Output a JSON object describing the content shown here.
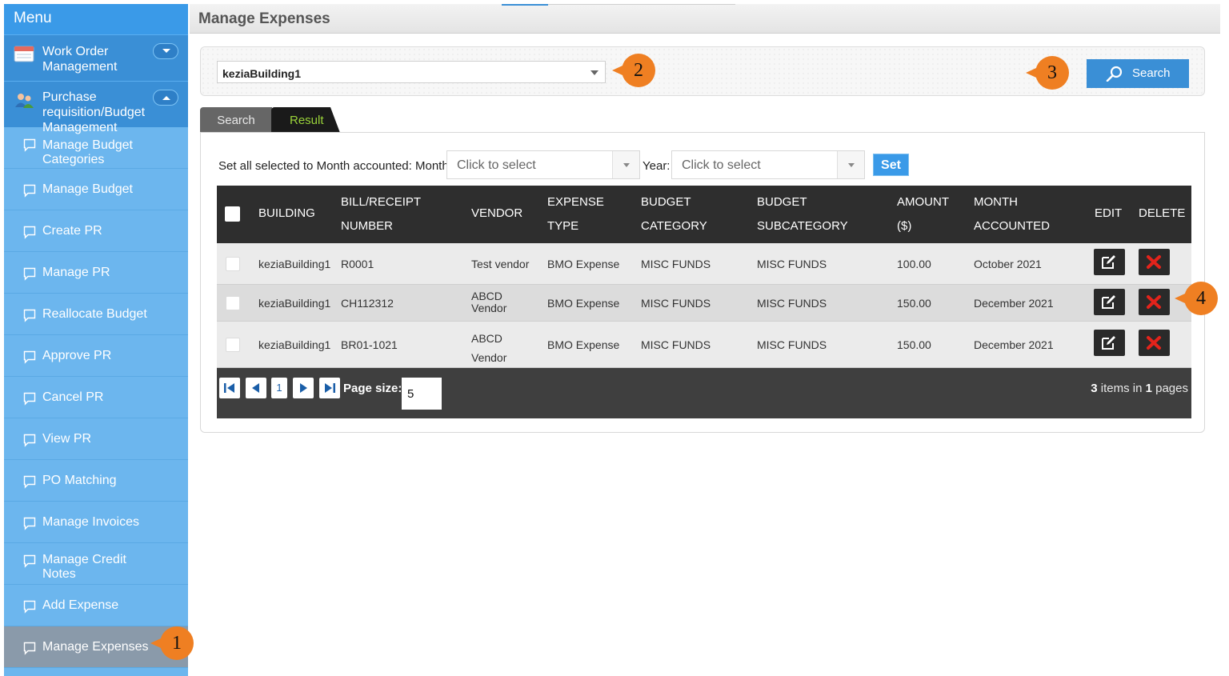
{
  "sidebar": {
    "title": "Menu",
    "groups": [
      {
        "label_line1": "Work Order",
        "label_line2": "Management",
        "icon": "calendar-icon",
        "expanded": false
      },
      {
        "label_line1": "Purchase",
        "label_line2": "requisition/Budget",
        "label_line3": "Management",
        "icon": "users-icon",
        "expanded": true
      }
    ],
    "items": [
      {
        "label": "Manage Budget",
        "label2": "Categories"
      },
      {
        "label": "Manage Budget"
      },
      {
        "label": "Create PR"
      },
      {
        "label": "Manage PR"
      },
      {
        "label": "Reallocate Budget"
      },
      {
        "label": "Approve PR"
      },
      {
        "label": "Cancel PR"
      },
      {
        "label": "View PR"
      },
      {
        "label": "PO Matching"
      },
      {
        "label": "Manage Invoices"
      },
      {
        "label": "Manage Credit",
        "label2": "Notes"
      },
      {
        "label": "Add Expense"
      },
      {
        "label": "Manage Expenses",
        "active": true
      }
    ]
  },
  "header": {
    "title": "Manage Expenses"
  },
  "filter": {
    "building_value": "keziaBuilding1",
    "search_label": "Search"
  },
  "tabs": [
    {
      "label": "Search"
    },
    {
      "label": "Result",
      "active": true
    }
  ],
  "month_setter": {
    "label": "Set all selected to Month accounted: Month:",
    "month_placeholder": "Click to select",
    "year_label": "Year:",
    "year_placeholder": "Click to select",
    "set_label": "Set"
  },
  "table": {
    "columns": [
      {
        "line1": "BUILDING"
      },
      {
        "line1": "BILL/RECEIPT",
        "line2": "NUMBER"
      },
      {
        "line1": "VENDOR"
      },
      {
        "line1": "EXPENSE",
        "line2": "TYPE"
      },
      {
        "line1": "BUDGET",
        "line2": "CATEGORY"
      },
      {
        "line1": "BUDGET",
        "line2": "SUBCATEGORY"
      },
      {
        "line1": "AMOUNT",
        "line2": "($)"
      },
      {
        "line1": "MONTH",
        "line2": "ACCOUNTED"
      },
      {
        "line1": "EDIT"
      },
      {
        "line1": "DELETE"
      }
    ],
    "rows": [
      {
        "building": "keziaBuilding1",
        "bill": "R0001",
        "vendor": "Test vendor",
        "vendor2": "",
        "expense_type": "BMO Expense",
        "category": "MISC FUNDS",
        "subcategory": "MISC FUNDS",
        "amount": "100.00",
        "month": "October 2021"
      },
      {
        "building": "keziaBuilding1",
        "bill": "CH112312",
        "vendor": "ABCD",
        "vendor2": "Vendor",
        "expense_type": "BMO Expense",
        "category": "MISC FUNDS",
        "subcategory": "MISC FUNDS",
        "amount": "150.00",
        "month": "December 2021"
      },
      {
        "building": "keziaBuilding1",
        "bill": "BR01-1021",
        "vendor": "ABCD",
        "vendor2": "Vendor",
        "expense_type": "BMO Expense",
        "category": "MISC FUNDS",
        "subcategory": "MISC FUNDS",
        "amount": "150.00",
        "month": "December 2021"
      }
    ]
  },
  "pager": {
    "current_page": "1",
    "page_size_label": "Page size:",
    "page_size": "5",
    "items_count": "3",
    "items_text": "items in",
    "pages_count": "1",
    "pages_text": "pages"
  },
  "callouts": [
    "1",
    "2",
    "3",
    "4"
  ],
  "colors": {
    "accent": "#3a8fd6",
    "callout": "#ef7f22",
    "sidebar": "#6cb6ee",
    "delete_icon": "#e3231b",
    "result_tab_text": "#9ad33a"
  }
}
